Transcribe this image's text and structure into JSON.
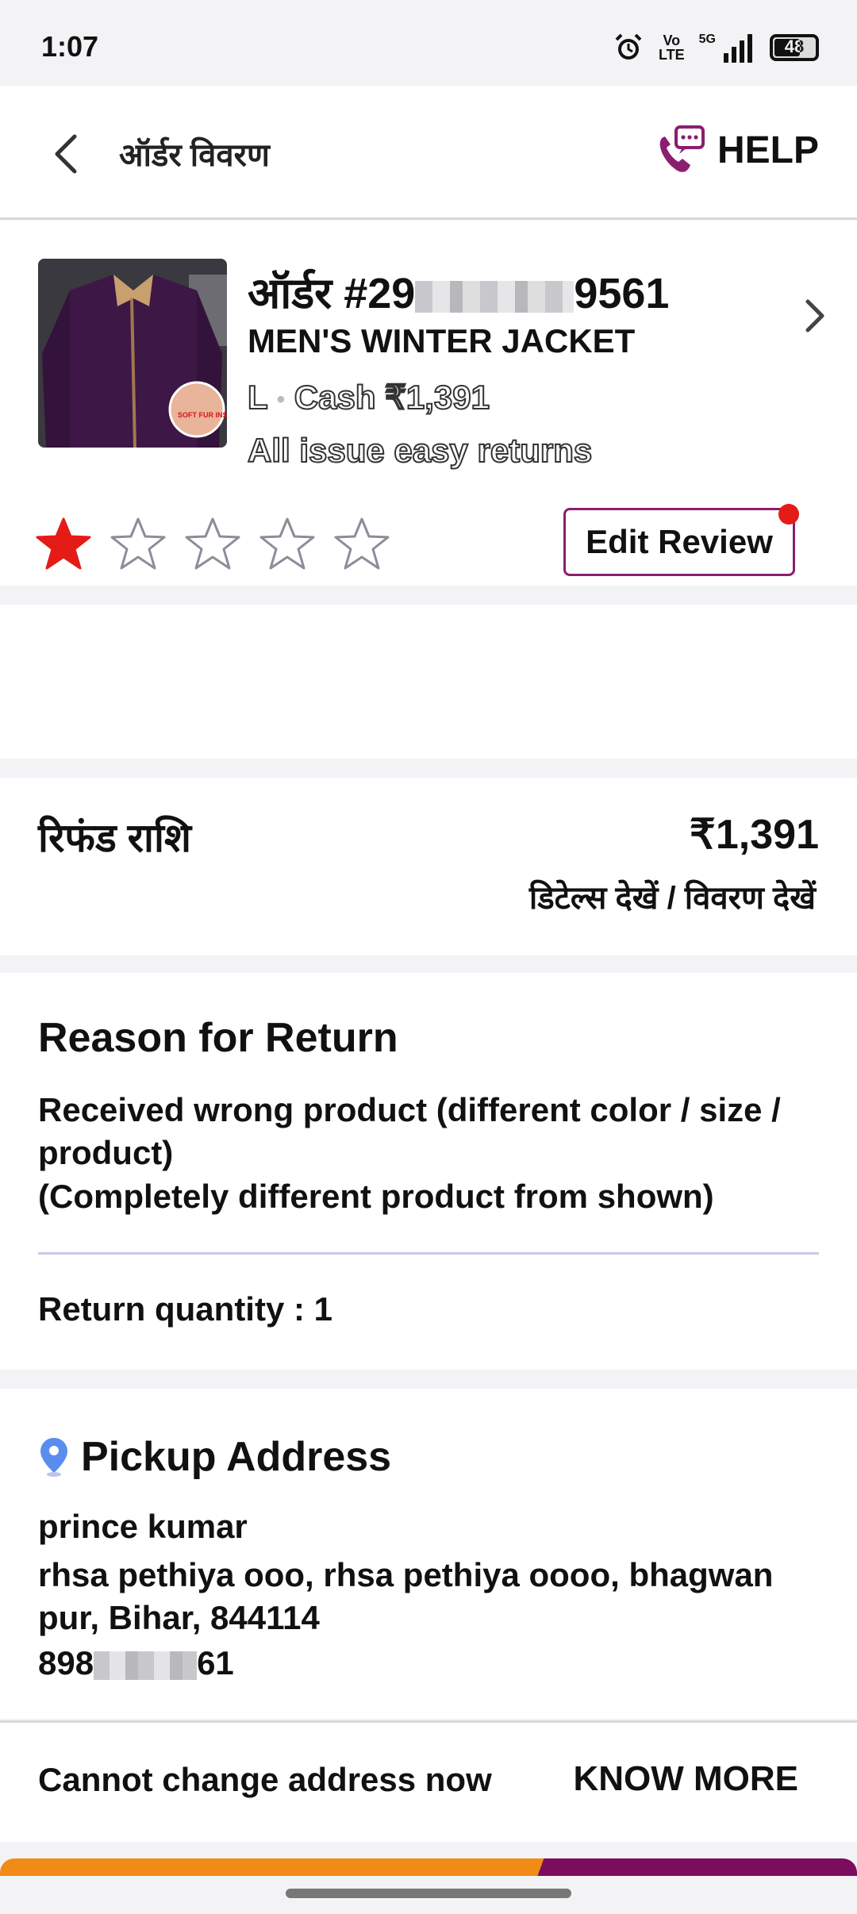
{
  "status_bar": {
    "time": "1:07",
    "network_volte": "Vo\nLTE",
    "network_5g": "5G",
    "battery": "48"
  },
  "header": {
    "title": "ऑर्डर विवरण",
    "help_label": "HELP"
  },
  "order": {
    "id_prefix": "ऑर्डर #29",
    "id_suffix": "9561",
    "product_name": "MEN'S WINTER JACKET",
    "size": "L",
    "payment": "Cash ₹1,391",
    "returns_note": "All issue easy returns",
    "rating": 1,
    "max_rating": 5,
    "edit_review_label": "Edit Review"
  },
  "refund": {
    "label": "रिफंड राशि",
    "amount": "₹1,391",
    "details_link": "डिटेल्स देखें / विवरण देखें"
  },
  "reason": {
    "title": "Reason for Return",
    "text": "Received wrong product (different color / size / product)",
    "subtext": "(Completely different product from shown)",
    "quantity": "Return quantity : 1"
  },
  "pickup": {
    "title": "Pickup Address",
    "name": "prince kumar",
    "address": "rhsa pethiya ooo, rhsa pethiya oooo, bhagwan pur, Bihar, 844114",
    "phone_prefix": "898",
    "phone_suffix": "61"
  },
  "address_bar": {
    "message": "Cannot change address now",
    "action_label": "KNOW MORE"
  },
  "colors": {
    "brand": "#8b1e6e",
    "star_active": "#e41b17",
    "stripe_orange": "#f08c16",
    "stripe_purple": "#7b0c5e"
  }
}
